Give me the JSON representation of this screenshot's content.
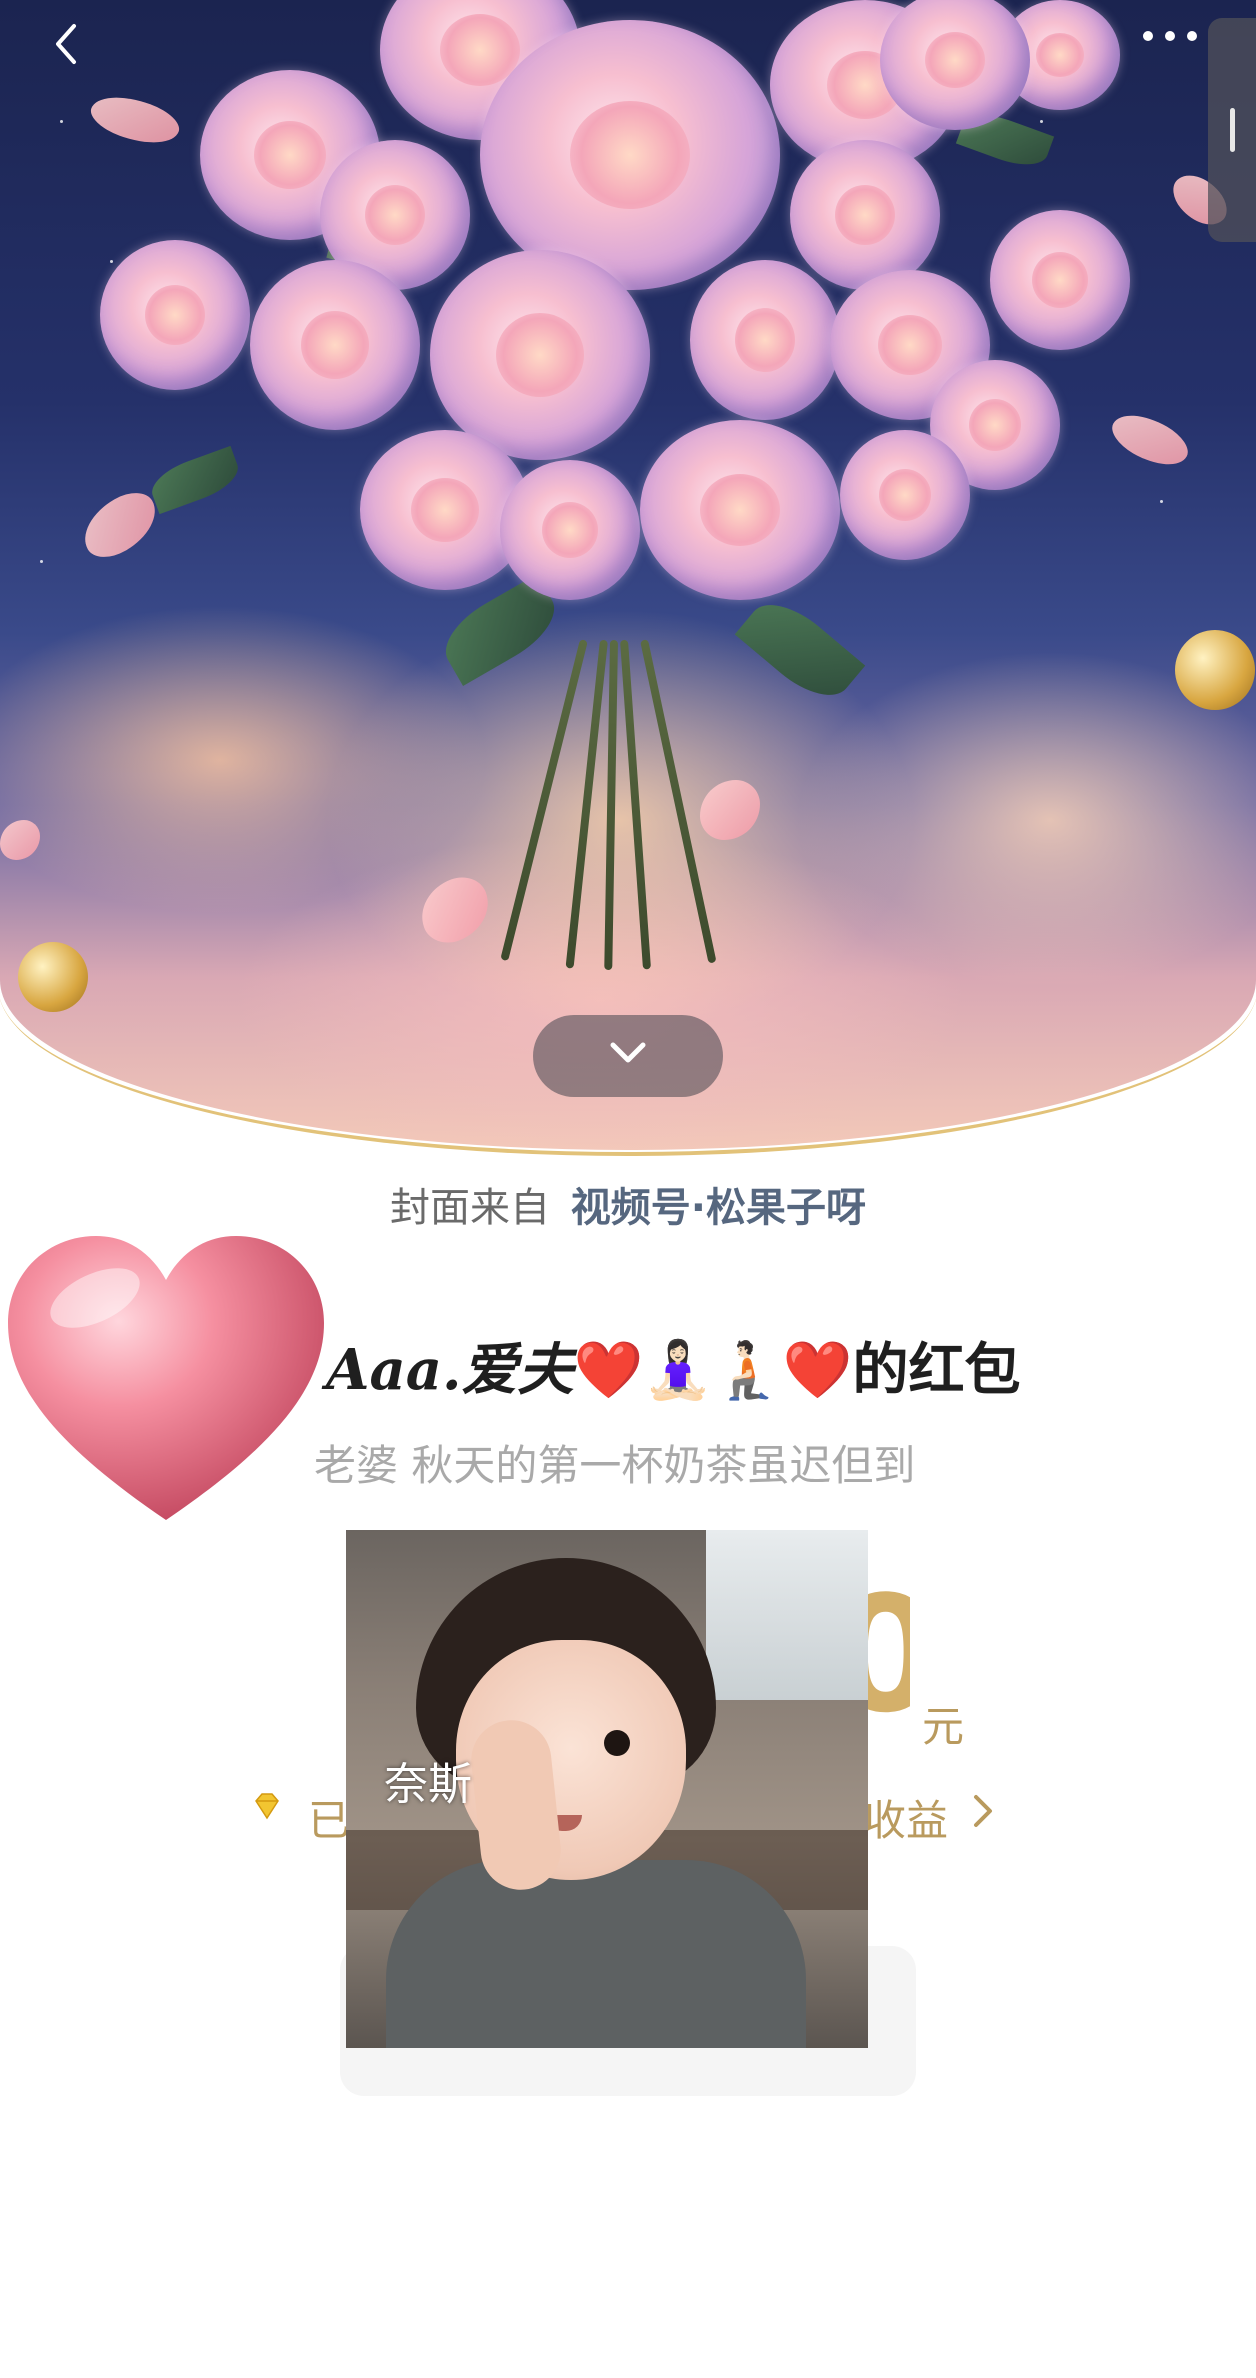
{
  "cover": {
    "source_prefix": "封面来自",
    "source_link": "视频号·松果子呀"
  },
  "sender": {
    "name": "Aaa.爱夫",
    "heart_emoji": "❤️",
    "emoji_a": "🧘🏻‍♀️",
    "emoji_b": "🧎🏻",
    "suffix": "的红包"
  },
  "blessing": "老婆 秋天的第一杯奶茶虽迟但到",
  "amount": {
    "visible_digit": "0",
    "unit": "元"
  },
  "earnings": {
    "left_text": "已",
    "right_text": "收益",
    "icon": "diamond-icon"
  },
  "sticker": {
    "caption": "奈斯"
  },
  "icons": {
    "back": "chevron-left-icon",
    "more": "more-icon",
    "collapse": "chevron-down-icon",
    "heart": "heart-icon"
  },
  "colors": {
    "link": "#56677f",
    "gold": "#b99a5e",
    "cover_border": "#e2c279"
  }
}
